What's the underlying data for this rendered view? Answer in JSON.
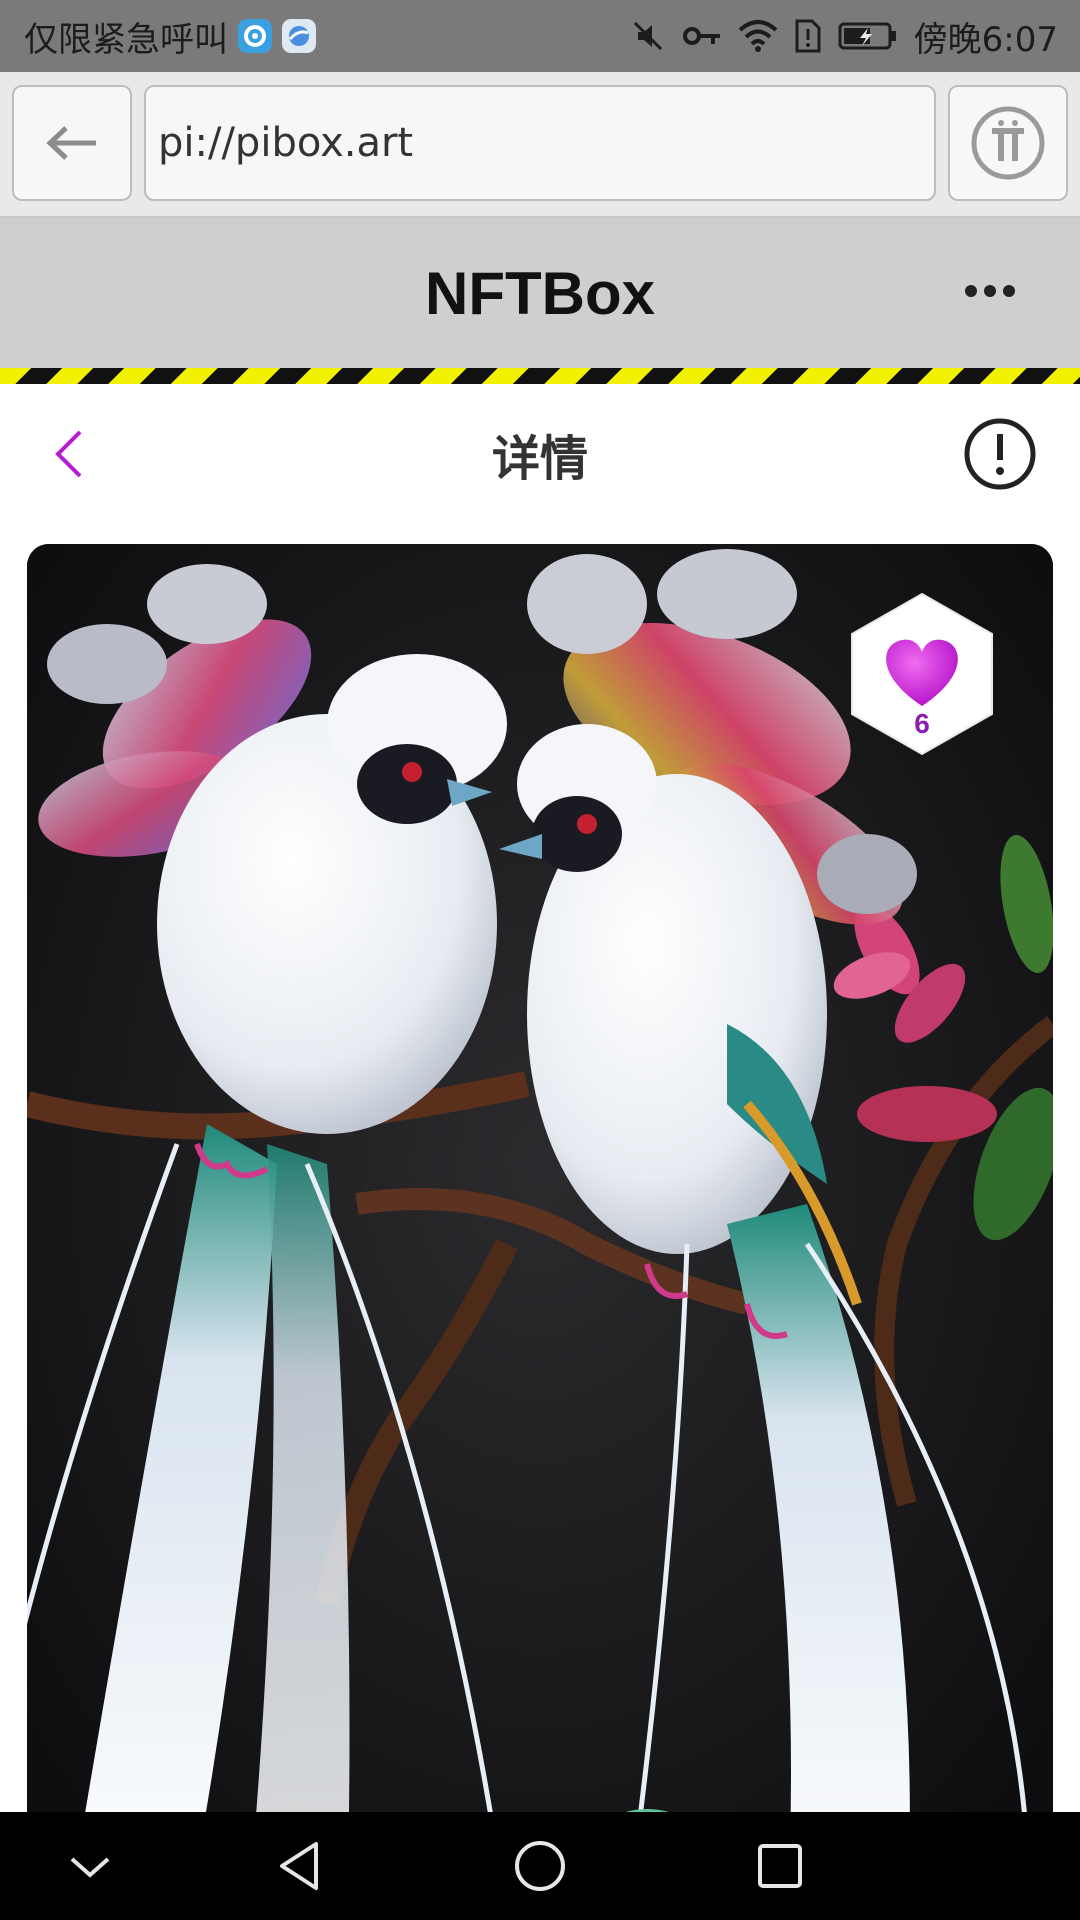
{
  "status_bar": {
    "carrier_text": "仅限紧急呼叫",
    "time_text": "傍晚6:07",
    "icons": [
      "vpn-app-icon",
      "browser-app-icon",
      "mute-icon",
      "key-icon",
      "wifi-icon",
      "sim-alert-icon",
      "battery-charging-icon"
    ]
  },
  "browser": {
    "url": "pi://pibox.art",
    "back_icon": "arrow-left-icon",
    "pi_icon": "pi-logo-icon"
  },
  "app_header": {
    "title": "NFTBox",
    "more_icon": "more-dots-icon"
  },
  "detail": {
    "title": "详情",
    "back_icon": "chevron-left-icon",
    "info_icon": "exclamation-circle-icon",
    "like_count": "6",
    "artwork": "two-white-birds-of-paradise-on-branch"
  },
  "colors": {
    "accent": "#b61bd6",
    "like_count": "#8a1fb0",
    "hazard_yellow": "#f2f200"
  },
  "navbar": {
    "icons": [
      "collapse-icon",
      "back-triangle-icon",
      "home-circle-icon",
      "recents-square-icon"
    ]
  }
}
